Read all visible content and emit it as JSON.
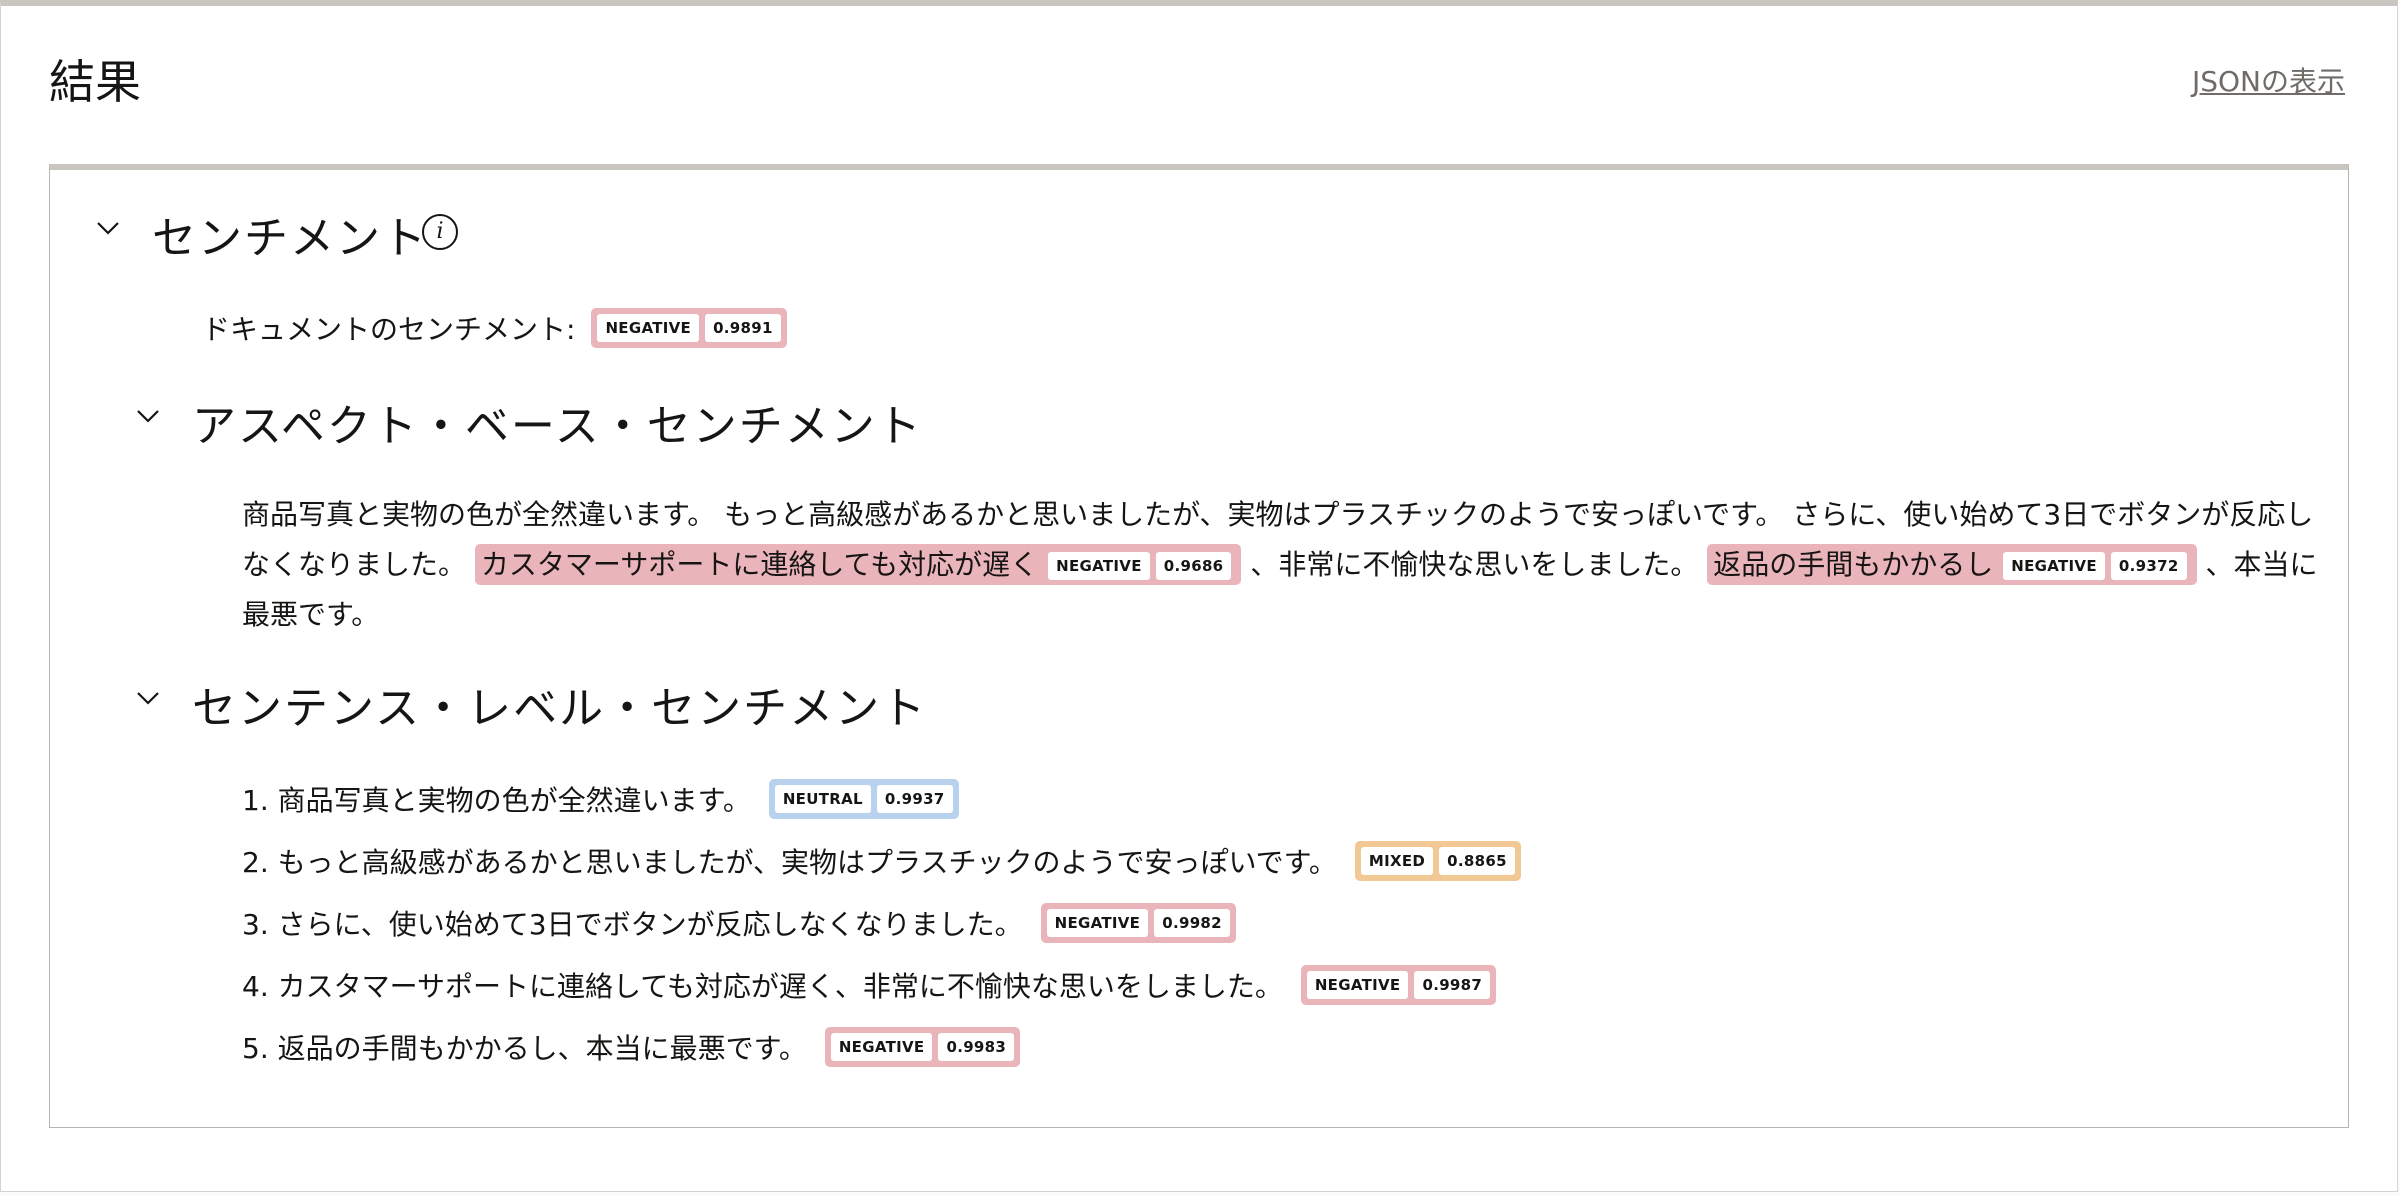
{
  "header": {
    "title": "結果",
    "json_link": "JSONの表示"
  },
  "sentiment": {
    "title": "センチメント",
    "info_glyph": "i",
    "doc_label": "ドキュメントのセンチメント:",
    "doc_badge": {
      "label": "NEGATIVE",
      "score": "0.9891"
    },
    "aspect": {
      "title": "アスペクト・ベース・センチメント",
      "text1": "商品写真と実物の色が全然違います。 もっと高級感があるかと思いましたが、実物はプラスチックのようで安っぽいです。 さらに、使い始めて3日でボタンが反応しなくなりました。 ",
      "aspect1": {
        "text": "カスタマーサポートに連絡しても対応が遅く",
        "label": "NEGATIVE",
        "score": "0.9686"
      },
      "text2": " 、非常に不愉快な思いをしました。 ",
      "aspect2": {
        "text": "返品の手間もかかるし",
        "label": "NEGATIVE",
        "score": "0.9372"
      },
      "text3": " 、本当に最悪です。"
    },
    "sentence": {
      "title": "センテンス・レベル・センチメント",
      "items": [
        {
          "text": "1. 商品写真と実物の色が全然違います。",
          "label": "NEUTRAL",
          "score": "0.9937",
          "color": "#b8d2ee"
        },
        {
          "text": "2. もっと高級感があるかと思いましたが、実物はプラスチックのようで安っぽいです。",
          "label": "MIXED",
          "score": "0.8865",
          "color": "#f2c994"
        },
        {
          "text": "3. さらに、使い始めて3日でボタンが反応しなくなりました。",
          "label": "NEGATIVE",
          "score": "0.9982",
          "color": "#eab4bb"
        },
        {
          "text": "4. カスタマーサポートに連絡しても対応が遅く、非常に不愉快な思いをしました。",
          "label": "NEGATIVE",
          "score": "0.9987",
          "color": "#eab4bb"
        },
        {
          "text": "5. 返品の手間もかかるし、本当に最悪です。",
          "label": "NEGATIVE",
          "score": "0.9983",
          "color": "#eab4bb"
        }
      ]
    }
  }
}
